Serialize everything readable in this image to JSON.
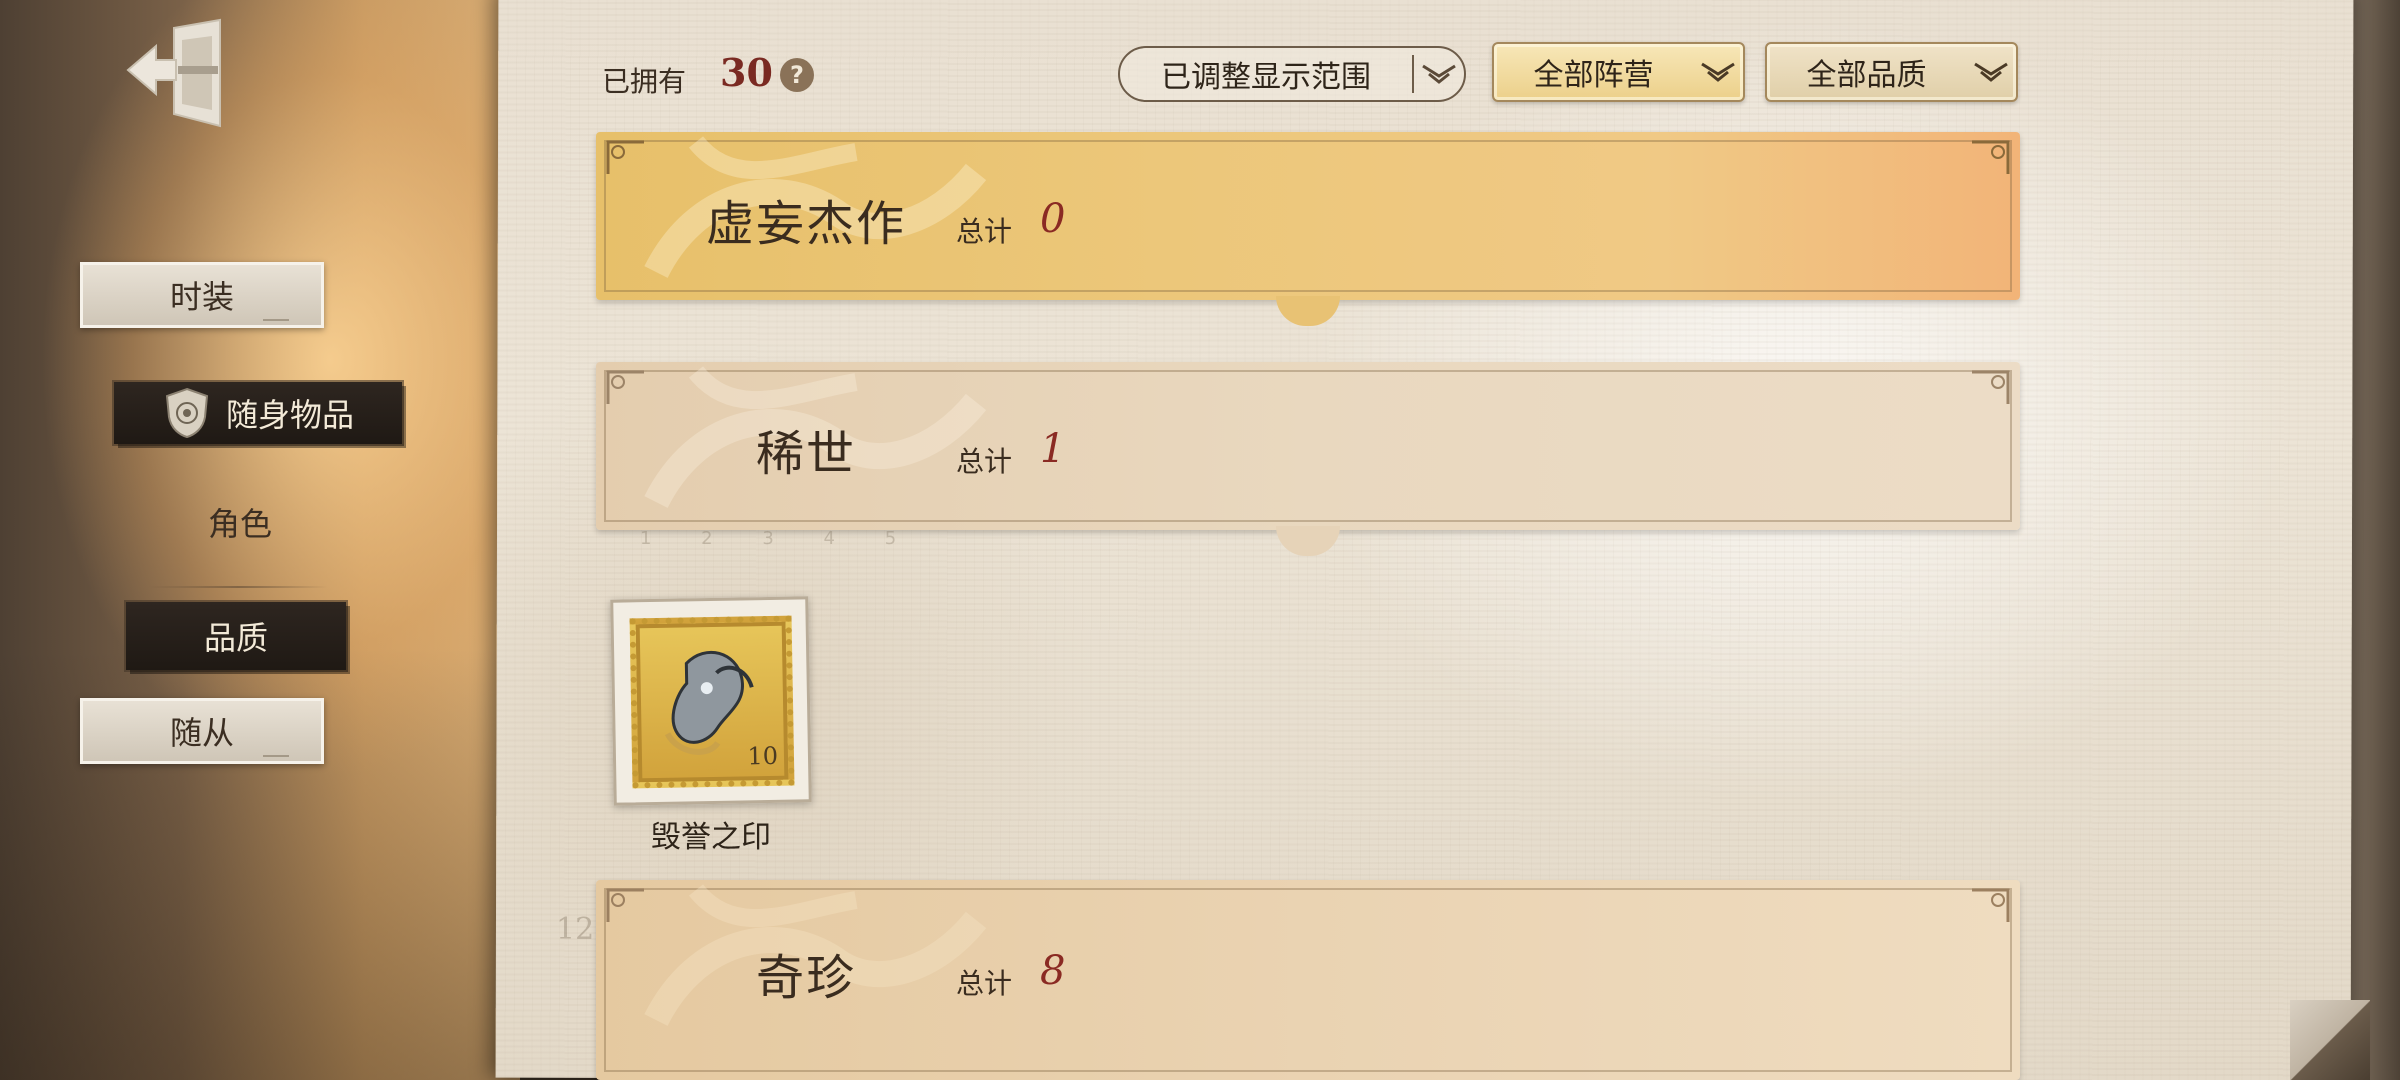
{
  "nav": {
    "items": [
      {
        "label": "时装"
      },
      {
        "label": "随身物品"
      },
      {
        "label": "角色"
      },
      {
        "label": "品质"
      },
      {
        "label": "随从"
      }
    ]
  },
  "header": {
    "owned_label": "已拥有",
    "owned_count": "30",
    "help_icon": "?",
    "filters": {
      "range": "已调整显示范围",
      "faction": "全部阵营",
      "quality": "全部品质"
    }
  },
  "sections": [
    {
      "title": "虚妄杰作",
      "total_label": "总计",
      "total": "0"
    },
    {
      "title": "稀世",
      "total_label": "总计",
      "total": "1"
    },
    {
      "title": "奇珍",
      "total_label": "总计",
      "total": "8"
    }
  ],
  "items": [
    {
      "name": "毁誉之印",
      "stamp_value": "10"
    }
  ],
  "background": {
    "faint_number": "12"
  },
  "colors": {
    "accent_count": "#7a2a22",
    "total_value": "#8a2a23",
    "gold_banner": "#e7c06a",
    "nav_selected": "#2e2620"
  },
  "icons": {
    "exit": "exit-door-icon",
    "help": "question-circle-icon",
    "chevron": "double-chevron-down-icon",
    "shield": "shield-emblem-icon"
  }
}
